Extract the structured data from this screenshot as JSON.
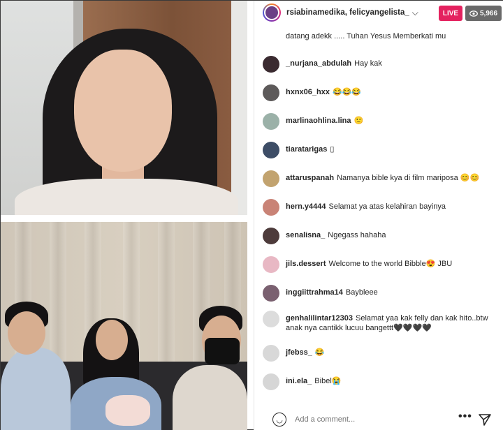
{
  "header": {
    "host_names": "rsiabinamedika, felicyangelista_",
    "live_label": "LIVE",
    "viewer_count": "5,966"
  },
  "comments": [
    {
      "user": "",
      "text": "datang adekk ..... Tuhan Yesus Memberkati mu",
      "avatar_color": "#8b6f8f"
    },
    {
      "user": "_nurjana_abdulah",
      "text": "Hay kak",
      "avatar_color": "#3a2a30"
    },
    {
      "user": "hxnx06_hxx",
      "text": "😂😂😂",
      "avatar_color": "#5d5a5a"
    },
    {
      "user": "marlinaohlina.lina",
      "text": "🙂",
      "avatar_color": "#9bb1a8"
    },
    {
      "user": "tiaratarigas",
      "text": "▯",
      "avatar_color": "#3d4d66"
    },
    {
      "user": "attaruspanah",
      "text": "Namanya bible kya di film mariposa 😊😊",
      "avatar_color": "#c2a36f"
    },
    {
      "user": "hern.y4444",
      "text": "Selamat ya atas kelahiran bayinya",
      "avatar_color": "#c98376"
    },
    {
      "user": "senalisna_",
      "text": "Ngegass hahaha",
      "avatar_color": "#4d3b3b"
    },
    {
      "user": "jils.dessert",
      "text": "Welcome to the world Bibble😍 JBU",
      "avatar_color": "#e8b8c4"
    },
    {
      "user": "inggiittrahma14",
      "text": "Baybleee",
      "avatar_color": "#7a6070"
    },
    {
      "user": "genhalilintar12303",
      "text": "Selamat yaa kak felly dan kak hito..btw anak nya cantikk lucuu bangettt🖤🖤🖤🖤",
      "avatar_color": "#dcdcdc"
    },
    {
      "user": "jfebss_",
      "text": "😂",
      "avatar_color": "#d8d8d8"
    },
    {
      "user": "ini.ela_",
      "text": "Bibel😭",
      "avatar_color": "#d6d6d6"
    }
  ],
  "composer": {
    "placeholder": "Add a comment..."
  }
}
